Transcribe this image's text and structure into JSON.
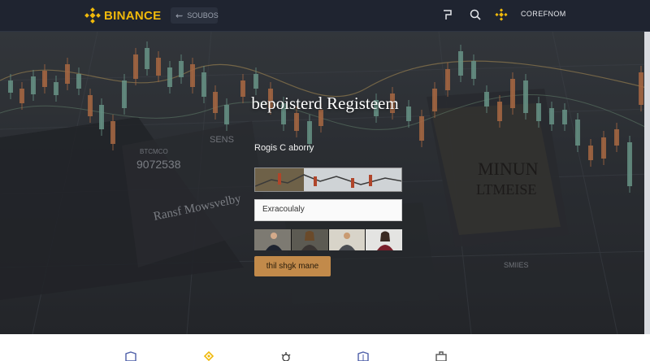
{
  "brand": {
    "name": "BINANCE",
    "accent": "#f0b90b"
  },
  "header": {
    "search_text": "SOUBOS",
    "user_label": "COREFNOM",
    "icons": [
      "flag-icon",
      "search-icon",
      "binance-diamond-icon"
    ]
  },
  "hero": {
    "title": "bepoisterd Registeem",
    "form_label": "Rogis C aborry",
    "input_value": "Exracoulaly",
    "cta_label": "thil shgk mane",
    "bg_texts": [
      "SENS",
      "BTCMCO",
      "9072538",
      "Ransf Mowsvelby",
      "MINUN",
      "LTMEISE",
      "SMIIES"
    ]
  },
  "bottom": {
    "icons": [
      "shield-icon",
      "binance-diamond-icon",
      "gear-icon",
      "shield-outline-icon",
      "briefcase-icon"
    ]
  },
  "colors": {
    "header_bg": "#1f2430",
    "cta_bg": "#c28a4a"
  }
}
